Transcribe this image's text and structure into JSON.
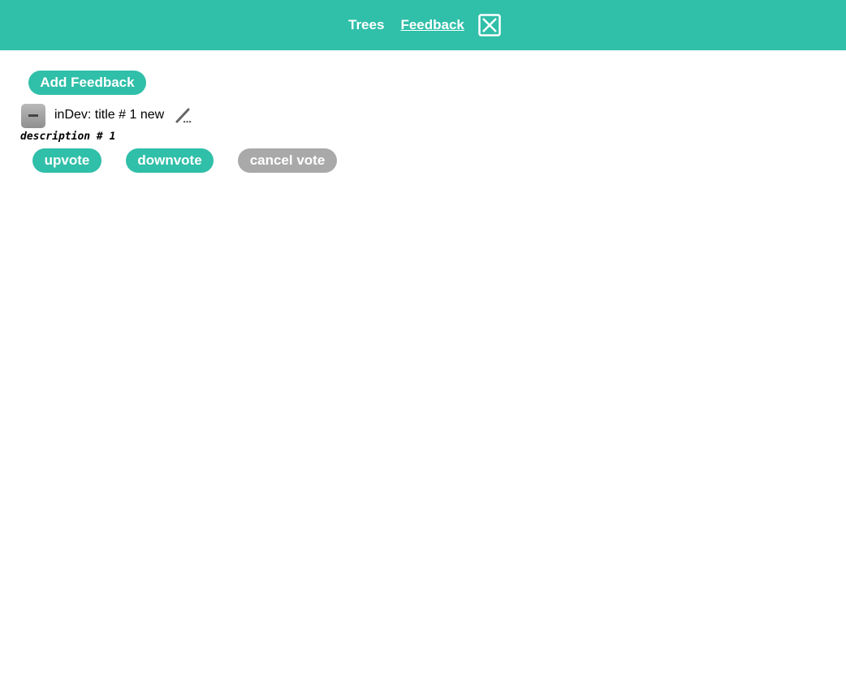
{
  "nav": {
    "trees_label": "Trees",
    "feedback_label": "Feedback",
    "close_icon": "close-box-icon"
  },
  "add_feedback_label": "Add Feedback",
  "feedback_items": [
    {
      "title": "inDev: title # 1 new",
      "description": "description # 1",
      "upvote_label": "upvote",
      "downvote_label": "downvote",
      "cancel_vote_label": "cancel vote"
    }
  ],
  "colors": {
    "accent": "#30bfa9",
    "muted_button": "#a9a9a9",
    "collapse_button": "#9e9e9e",
    "edit_icon": "#666666"
  }
}
